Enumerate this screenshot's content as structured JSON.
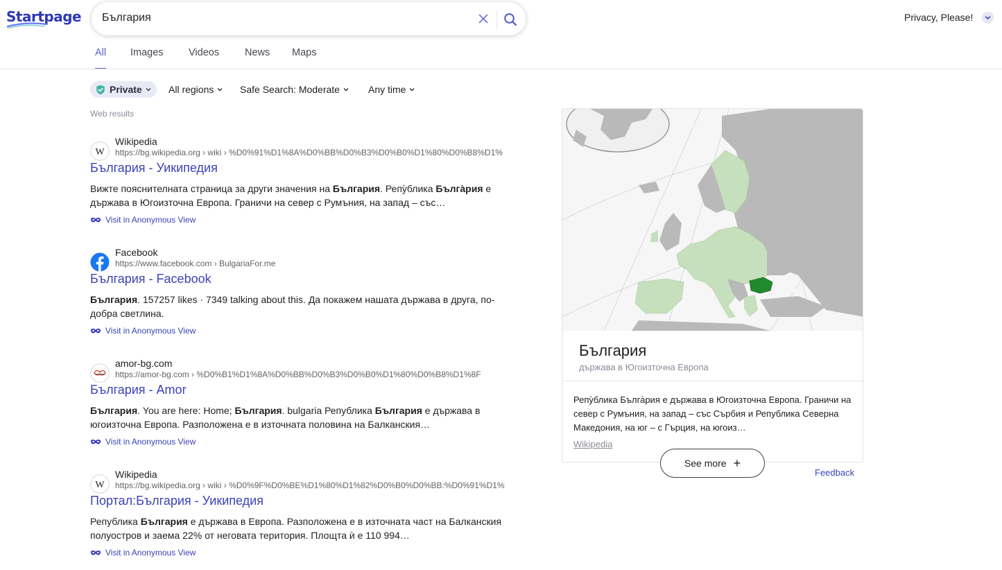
{
  "logo": {
    "text": "Startpage"
  },
  "search": {
    "query": "България"
  },
  "header": {
    "privacy_label": "Privacy, Please!"
  },
  "tabs": [
    {
      "label": "All",
      "active": true
    },
    {
      "label": "Images",
      "active": false
    },
    {
      "label": "Videos",
      "active": false
    },
    {
      "label": "News",
      "active": false
    },
    {
      "label": "Maps",
      "active": false
    }
  ],
  "filters": {
    "private": "Private",
    "regions": "All regions",
    "safe_search": "Safe Search: Moderate",
    "time": "Any time"
  },
  "web_results_label": "Web results",
  "results": [
    {
      "site": "Wikipedia",
      "url": "https://bg.wikipedia.org › wiki › %D0%91%D1%8A%D0%BB%D0%B3%D0%B0%D1%80%D0%B8%D1%",
      "title": "България - Уикипедия",
      "snippet_html": "Вижте пояснителната страница за други значения на <b>България</b>. Репу̀блика <b>Бълга̀рия</b> е държава в Югоизточна Европа. Граничи на север с Румъния, на запад – със…",
      "anon_label": "Visit in Anonymous View",
      "icon": "wikipedia-icon"
    },
    {
      "site": "Facebook",
      "url": "https://www.facebook.com › BulgariaFor.me",
      "title": "България - Facebook",
      "snippet_html": "<b>България</b>. 157257 likes · 7349 talking about this. Да покажем нашата държава в друга, по-добра светлина.",
      "anon_label": "Visit in Anonymous View",
      "icon": "facebook-icon"
    },
    {
      "site": "amor-bg.com",
      "url": "https://amor-bg.com › %D0%B1%D1%8A%D0%BB%D0%B3%D0%B0%D1%80%D0%B8%D1%8F",
      "title": "България - Amor",
      "snippet_html": "<b>България</b>. You are here: Home; <b>България</b>. bulgaria Република <b>България</b> е държава в югоизточна Европа. Разположена е в източната половина на Балканския…",
      "anon_label": "Visit in Anonymous View",
      "icon": "amor-icon"
    },
    {
      "site": "Wikipedia",
      "url": "https://bg.wikipedia.org › wiki › %D0%9F%D0%BE%D1%80%D1%82%D0%B0%D0%BB:%D0%91%D1%",
      "title": "Портал:България - Уикипедия",
      "snippet_html": "Република <b>България</b> е държава в Европа. Разположена е в източната част на Балканския полуостров и заема 22% от неговата територия. Площта ѝ е 110 994…",
      "anon_label": "Visit in Anonymous View",
      "icon": "wikipedia-icon"
    }
  ],
  "knowledge_panel": {
    "title": "България",
    "subtitle": "държава в Югоизточна Европа",
    "description": "Репу̀блика Бълга̀рия е държава в Югоизточна Европа. Граничи на север с Румъния, на запад – със Сърбия и Република Северна Македония, на юг – с Гърция, на югоиз…",
    "source": "Wikipedia",
    "see_more_label": "See more",
    "feedback_label": "Feedback",
    "colors": {
      "eu": "#c6e0bd",
      "highlight": "#1f8a2e",
      "land": "#b9b9b9",
      "sea": "#f6f6f6"
    }
  }
}
